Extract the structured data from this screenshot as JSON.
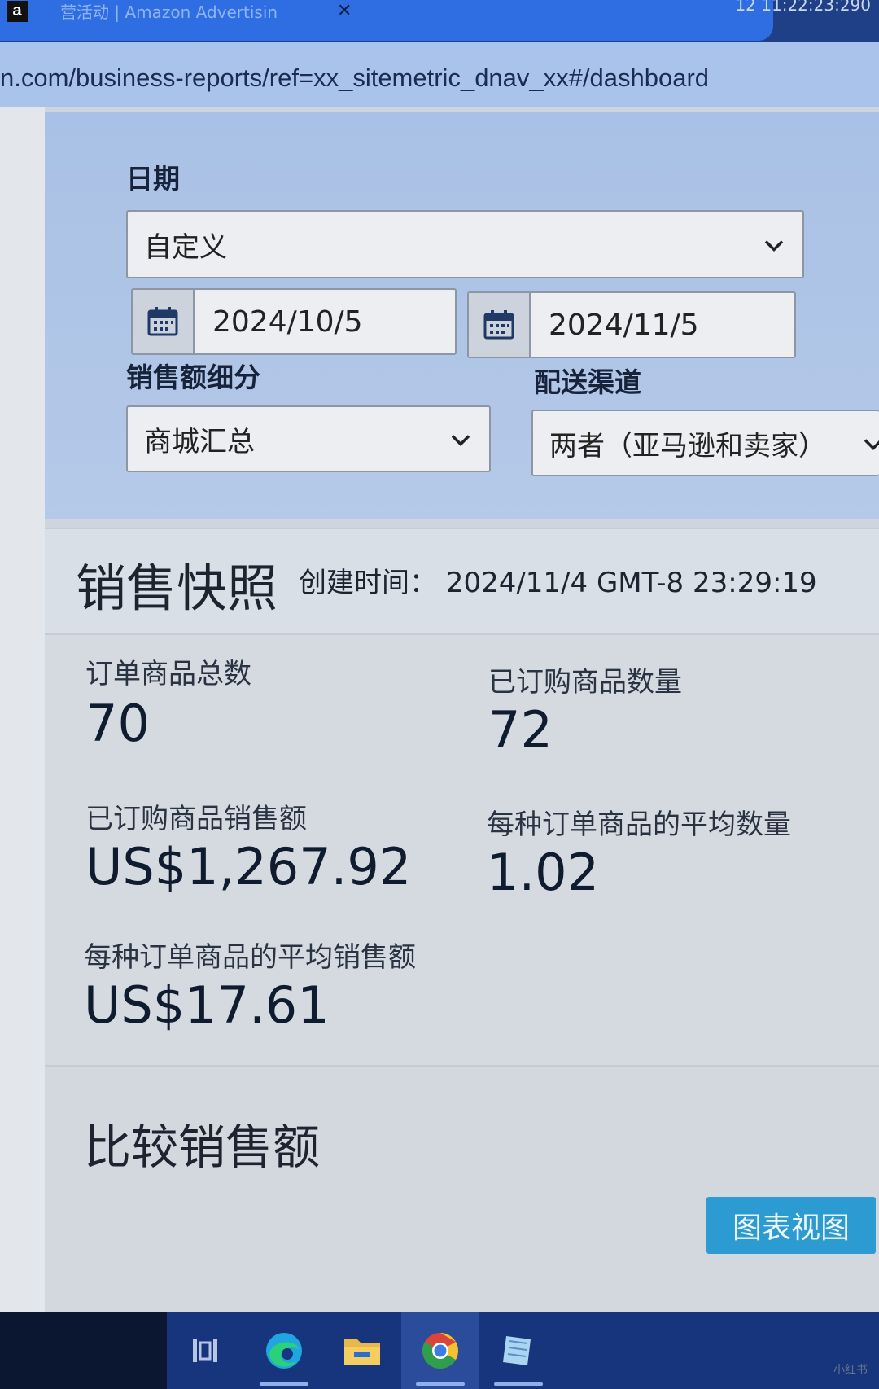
{
  "browser": {
    "tab_title": "营活动 | Amazon Advertisin",
    "tab_close": "✕",
    "clock": "12 11:22:23:290",
    "url": "n.com/business-reports/ref=xx_sitemetric_dnav_xx#/dashboard"
  },
  "filters": {
    "date_label": "日期",
    "date_range_value": "自定义",
    "start_date": "2024/10/5",
    "end_date": "2024/11/5",
    "sales_breakdown_label": "销售额细分",
    "sales_breakdown_value": "商城汇总",
    "fulfillment_label": "配送渠道",
    "fulfillment_value": "两者（亚马逊和卖家）"
  },
  "snapshot": {
    "title": "销售快照",
    "created": "创建时间：  2024/11/4 GMT-8 23:29:19",
    "metrics": [
      {
        "label": "订单商品总数",
        "value": "70"
      },
      {
        "label": "已订购商品数量",
        "value": "72"
      },
      {
        "label": "已订购商品销售额",
        "value": "US$1,267.92"
      },
      {
        "label": "每种订单商品的平均数量",
        "value": "1.02"
      },
      {
        "label": "每种订单商品的平均销售额",
        "value": "US$17.61"
      }
    ]
  },
  "compare": {
    "title": "比较销售额",
    "chart_view_button": "图表视图"
  },
  "watermark": "小红书"
}
